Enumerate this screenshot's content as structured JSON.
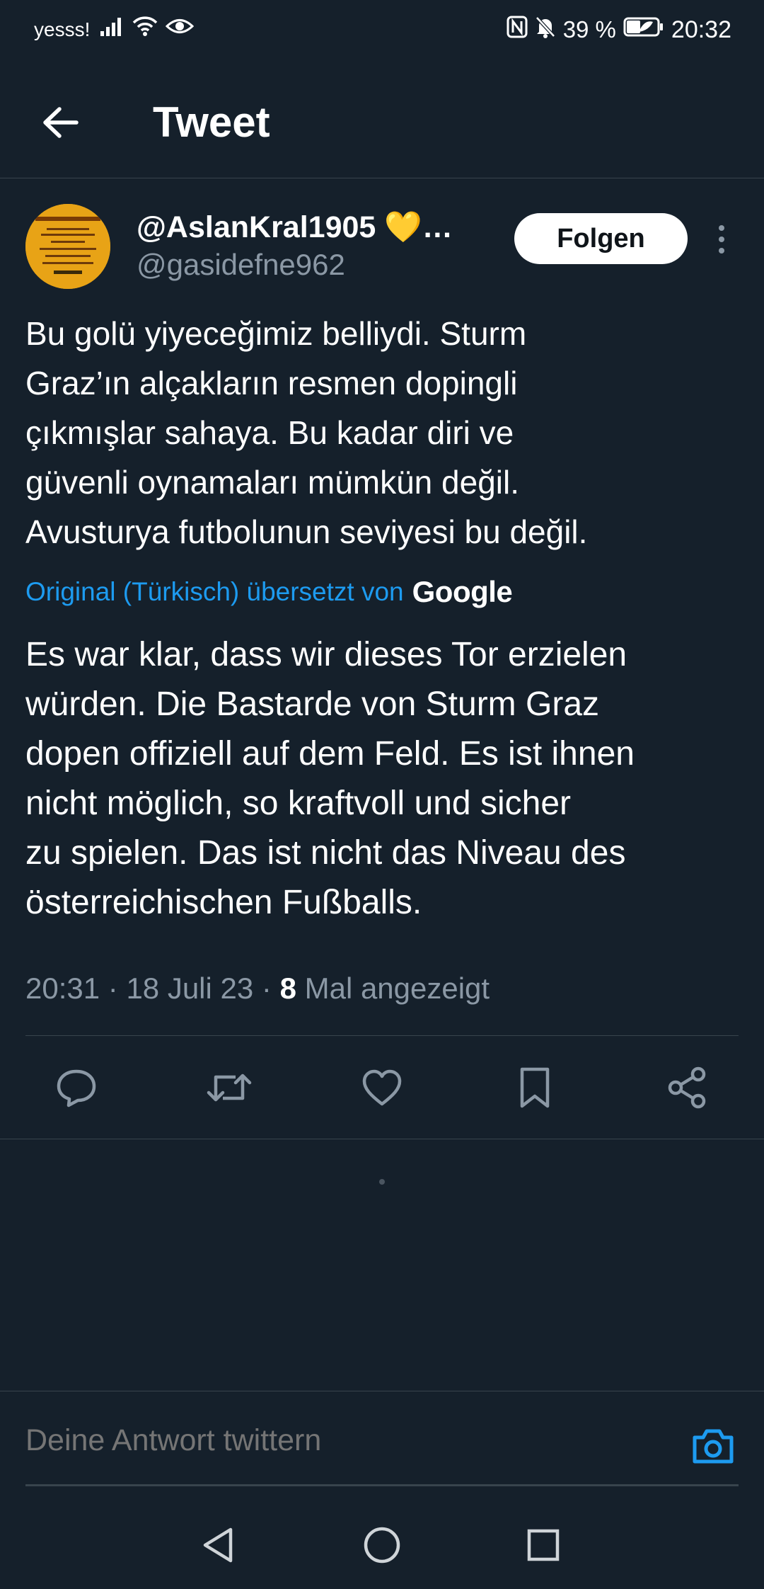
{
  "status_bar": {
    "carrier": "yesss!",
    "battery": "39 %",
    "time": "20:32"
  },
  "header": {
    "title": "Tweet"
  },
  "tweet": {
    "author_name": "@AslanKral1905 💛…",
    "author_handle": "@gasidefne962",
    "follow_label": "Folgen",
    "text": "Bu golü yiyeceğimiz belliydi. Sturm\nGraz’ın alçakların resmen dopingli\nçıkmışlar sahaya. Bu kadar diri ve\ngüvenli oynamaları mümkün değil.\nAvusturya futbolunun seviyesi bu değil.",
    "translation_label": "Original (Türkisch) übersetzt von",
    "translation_provider": "Google",
    "translated_text": "Es war klar, dass wir dieses Tor erzielen\nwürden. Die Bastarde von Sturm Graz\ndopen offiziell auf dem Feld. Es ist ihnen\nnicht möglich, so kraftvoll und sicher\nzu spielen. Das ist nicht das Niveau des\nösterreichischen Fußballs.",
    "time": "20:31",
    "date": "18 Juli 23",
    "views_count": "8",
    "views_label": "Mal angezeigt"
  },
  "actions": [
    {
      "name": "reply-icon"
    },
    {
      "name": "retweet-icon"
    },
    {
      "name": "like-icon"
    },
    {
      "name": "bookmark-icon"
    },
    {
      "name": "share-icon"
    }
  ],
  "reply": {
    "placeholder": "Deine Antwort twittern"
  },
  "colors": {
    "background": "#15202b",
    "accent": "#1d9bf0",
    "secondary_text": "#8b98a5",
    "divider": "#38444d"
  }
}
